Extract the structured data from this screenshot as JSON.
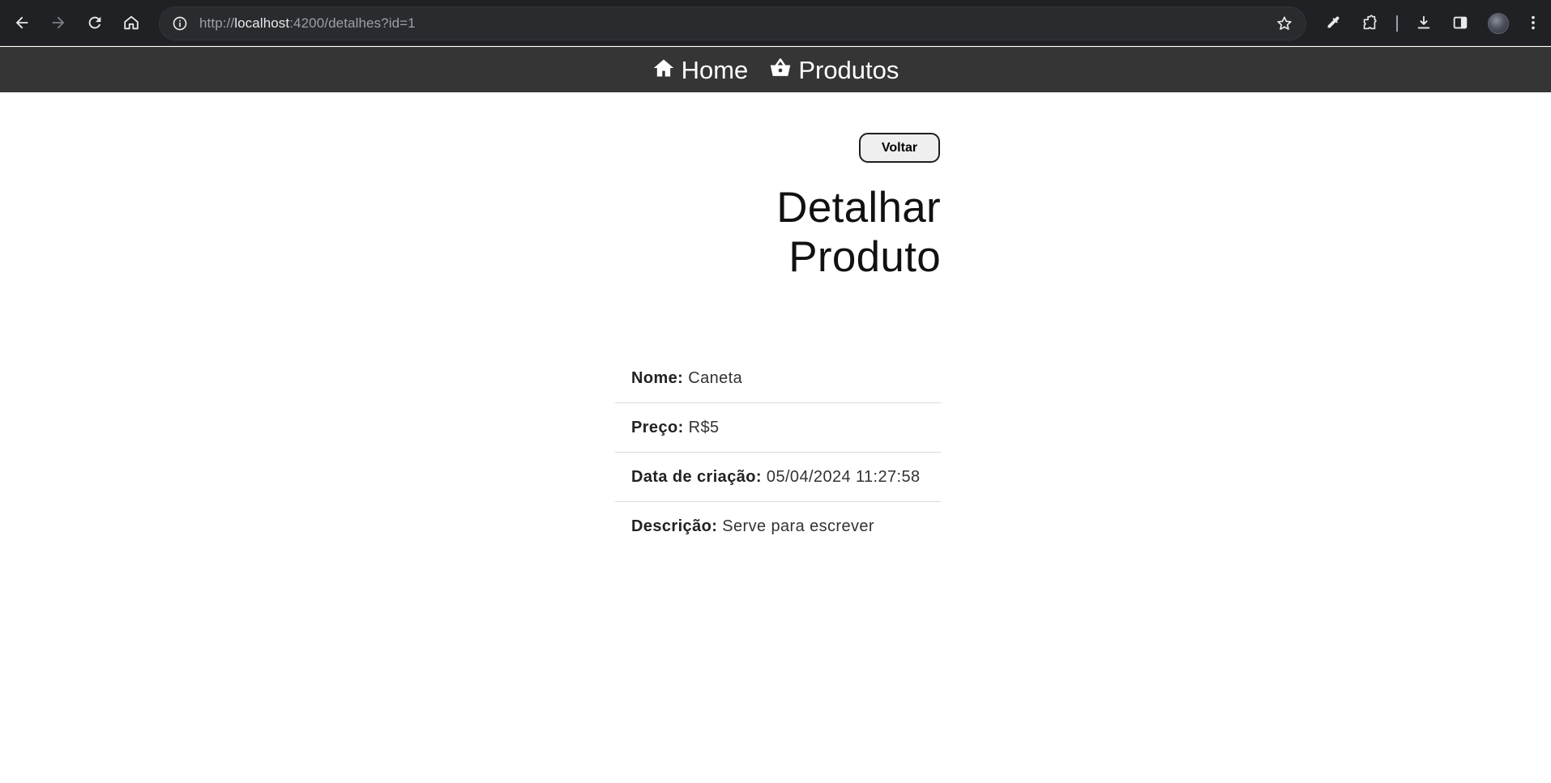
{
  "browser": {
    "url_scheme": "http://",
    "url_host": "localhost",
    "url_rest": ":4200/detalhes?id=1"
  },
  "nav": {
    "items": [
      {
        "label": "Home",
        "icon": "home-icon"
      },
      {
        "label": "Produtos",
        "icon": "basket-icon"
      }
    ]
  },
  "page": {
    "back_button": "Voltar",
    "title": "Detalhar Produto"
  },
  "details": {
    "items": [
      {
        "label": "Nome:",
        "value": "Caneta"
      },
      {
        "label": "Preço:",
        "value": "R$5"
      },
      {
        "label": "Data de criação:",
        "value": "05/04/2024 11:27:58"
      },
      {
        "label": "Descrição:",
        "value": "Serve para escrever"
      }
    ]
  }
}
